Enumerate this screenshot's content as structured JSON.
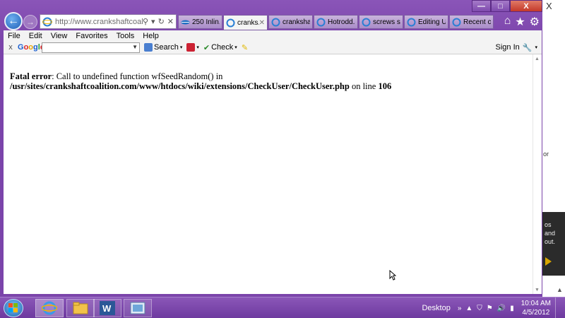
{
  "browser": {
    "url": "http://www.crankshaftcoali...",
    "tabs": [
      {
        "label": "250 Inlin...",
        "active": false
      },
      {
        "label": "cranks...",
        "active": true
      },
      {
        "label": "crankshaf...",
        "active": false
      },
      {
        "label": "Hotrodd...",
        "active": false
      },
      {
        "label": "screws sn...",
        "active": false
      },
      {
        "label": "Editing U...",
        "active": false
      },
      {
        "label": "Recent c...",
        "active": false
      }
    ],
    "caption": {
      "minimize": "—",
      "maximize": "□",
      "close": "X"
    }
  },
  "menu": [
    "File",
    "Edit",
    "View",
    "Favorites",
    "Tools",
    "Help"
  ],
  "google_toolbar": {
    "close": "x",
    "logo": "Google",
    "search_placeholder": "",
    "search_label": "Search",
    "check_label": "Check",
    "signin_label": "Sign In"
  },
  "page": {
    "error_label": "Fatal error",
    "error_message": ": Call to undefined function wfSeedRandom() in ",
    "error_path": "/usr/sites/crankshaftcoalition.com/www/htdocs/wiki/extensions/CheckUser/CheckUser.php",
    "line_prefix": " on line ",
    "line_number": "106"
  },
  "background": {
    "close_glyph": "X",
    "snippet": "or",
    "strip_lines": [
      "os",
      "and",
      "out."
    ]
  },
  "taskbar": {
    "desktop_label": "Desktop",
    "time": "10:04 AM",
    "date": "4/5/2012"
  },
  "colors": {
    "accent_purple": "#7b44aa",
    "taskbar_purple": "#6e3a9f"
  }
}
